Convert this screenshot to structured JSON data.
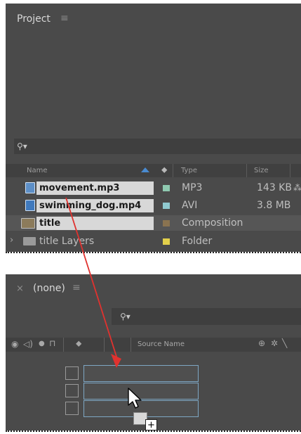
{
  "project": {
    "title": "Project",
    "menu_icon": "hamburger-icon",
    "search": {
      "icon": "search-icon",
      "placeholder": ""
    },
    "columns": {
      "name": "Name",
      "type": "Type",
      "size": "Size"
    },
    "items": [
      {
        "name": "movement.mp3",
        "type": "MP3",
        "size": "143 KB",
        "label_color": "#8fc9b0",
        "icon": "audio-file-icon"
      },
      {
        "name": "swimming_dog.mp4",
        "type": "AVI",
        "size": "3.8 MB",
        "label_color": "#8fc9cf",
        "icon": "video-file-icon"
      },
      {
        "name": "title",
        "type": "Composition",
        "size": "",
        "label_color": "#8a7350",
        "icon": "composition-icon"
      },
      {
        "name": "title Layers",
        "type": "Folder",
        "size": "",
        "label_color": "#e3d04b",
        "icon": "folder-icon"
      }
    ]
  },
  "timeline": {
    "close_icon": "×",
    "comp_name": "(none)",
    "menu_icon": "hamburger-icon",
    "search": {
      "icon": "search-icon"
    },
    "columns": {
      "source_name": "Source Name"
    }
  },
  "drag": {
    "cursor": "arrow-cursor-icon",
    "plus": "+",
    "arrow_color": "#e0322f"
  }
}
